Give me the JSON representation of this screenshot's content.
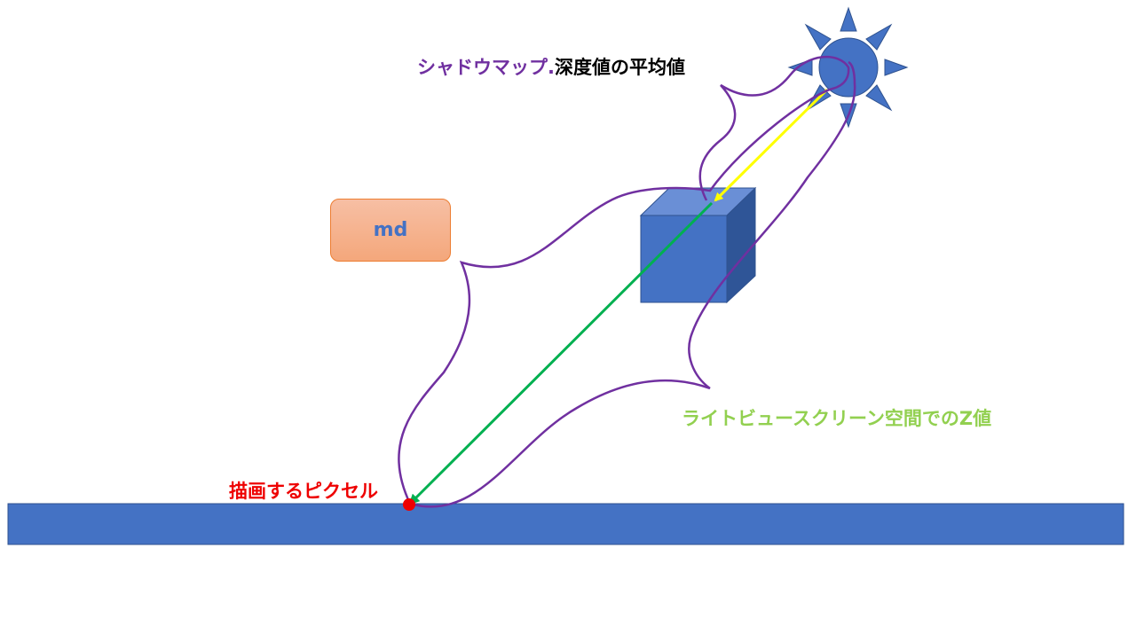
{
  "labels": {
    "shadow_map_prefix": "シャドウマップ.",
    "shadow_map_suffix": "深度値の平均値",
    "light_view_z": "ライトビュースクリーン空間でのZ値",
    "pixel": "描画するピクセル",
    "md": "md"
  },
  "colors": {
    "brace": "#7030a0",
    "light_ray": "#ffff00",
    "depth_ray": "#00b050",
    "shape_fill": "#4472c4",
    "pixel_dot": "#ee0000",
    "md_border": "#ed7d31"
  }
}
